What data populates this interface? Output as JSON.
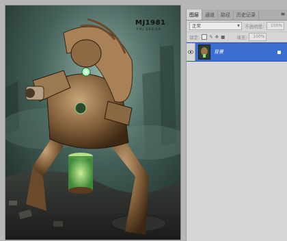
{
  "panel": {
    "tabs": [
      {
        "label": "图层"
      },
      {
        "label": "通道"
      },
      {
        "label": "路径"
      },
      {
        "label": "历史记录"
      }
    ],
    "blend_mode": "正常",
    "opacity_label": "不透明度:",
    "opacity_value": "100%",
    "lock_label": "锁定:",
    "fill_label": "填充:",
    "fill_value": "100%"
  },
  "layers": [
    {
      "name": "背景",
      "visible": true,
      "locked": true,
      "selected": true
    }
  ],
  "artwork": {
    "watermark": "MJ1981",
    "watermark_sub": "RMJ DESIGN"
  },
  "colors": {
    "workspace": "#b7b7b7",
    "panel": "#d6d6d6",
    "selected_layer": "#3a6fd1"
  }
}
